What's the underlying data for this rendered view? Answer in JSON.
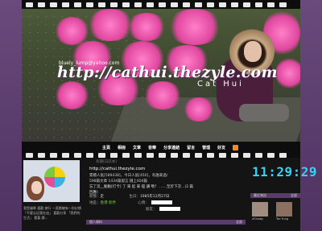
{
  "banner": {
    "email": "bluely_lump@yahoo.com",
    "url": "http://cathui.thezyle.com",
    "name": "Cat Hui"
  },
  "nav": {
    "items": [
      "主頁",
      "相冊",
      "文章",
      "音樂",
      "分享連結",
      "留言",
      "管理",
      "好友"
    ]
  },
  "profile": {
    "intro": "我是貓咪 喜歡 旅行 一直都擁有一份幻想 「不要忘記我在這」 喜歡分享 「我們的生活」 看著 讀..."
  },
  "blog": {
    "head": "有關[日誌本]",
    "url": "http://cathui.thezyle.com",
    "stats": [
      "累積人氣[589438]，今日人氣[450]，有誰來過/",
      "598篇文章 1434篇留言 鏈上404篇"
    ],
    "leave_message": "忘了流__動動[打卡] 了 來 起 來 喵 讀 嗎？ ……至於下次…(2 篇回應)",
    "status_label": "狀態：",
    "status": "走",
    "birthday_label": "生日：",
    "birthday": "1985年12月27日",
    "location_label": "地區：",
    "location": "香港 新界",
    "mood_label": "心情：",
    "fav_label": "朋友：",
    "friend_label": "我的朋友：",
    "bottom_bar_left": "個人資料",
    "bottom_bar_right": "全部"
  },
  "clock": {
    "time": "11:29:29"
  },
  "sidebar": {
    "section_title": "最近來訪",
    "section_more": "全部",
    "friends": [
      "#Cbaby",
      "Tse Yung"
    ]
  }
}
